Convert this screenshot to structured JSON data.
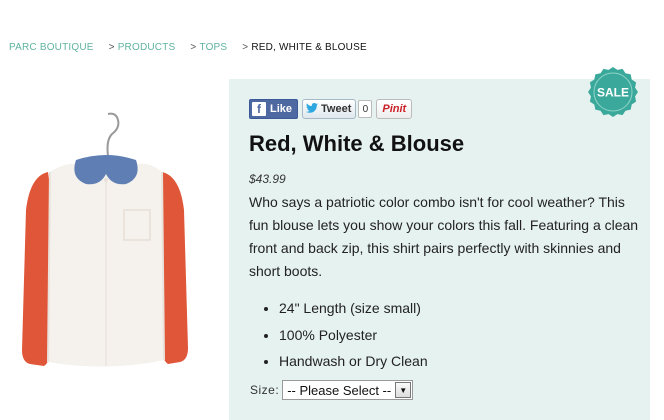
{
  "breadcrumb": {
    "home": "PARC BOUTIQUE",
    "products": "PRODUCTS",
    "tops": "TOPS",
    "current": "RED, WHITE & BLOUSE",
    "separator": ">"
  },
  "social": {
    "like_label": "Like",
    "fb_glyph": "f",
    "tweet_label": "Tweet",
    "tweet_count": "0",
    "pin_label": "Pinit"
  },
  "badge": {
    "label": "SALE",
    "color": "#3aa99b"
  },
  "product": {
    "title": "Red, White & Blouse",
    "price": "$43.99",
    "description": "Who says a patriotic color combo isn't for cool weather? This fun blouse lets you show your colors this fall. Featuring a clean front and back zip, this shirt pairs perfectly with skinnies and short boots.",
    "features": [
      "24\" Length (size small)",
      "100% Polyester",
      "Handwash or Dry Clean"
    ]
  },
  "size": {
    "label": "Size:",
    "selected": "-- Please Select --"
  },
  "colors": {
    "accent": "#5fb3a0",
    "panel_bg": "#e6f2f0",
    "facebook": "#4e69a2",
    "pinterest": "#cb2027"
  }
}
